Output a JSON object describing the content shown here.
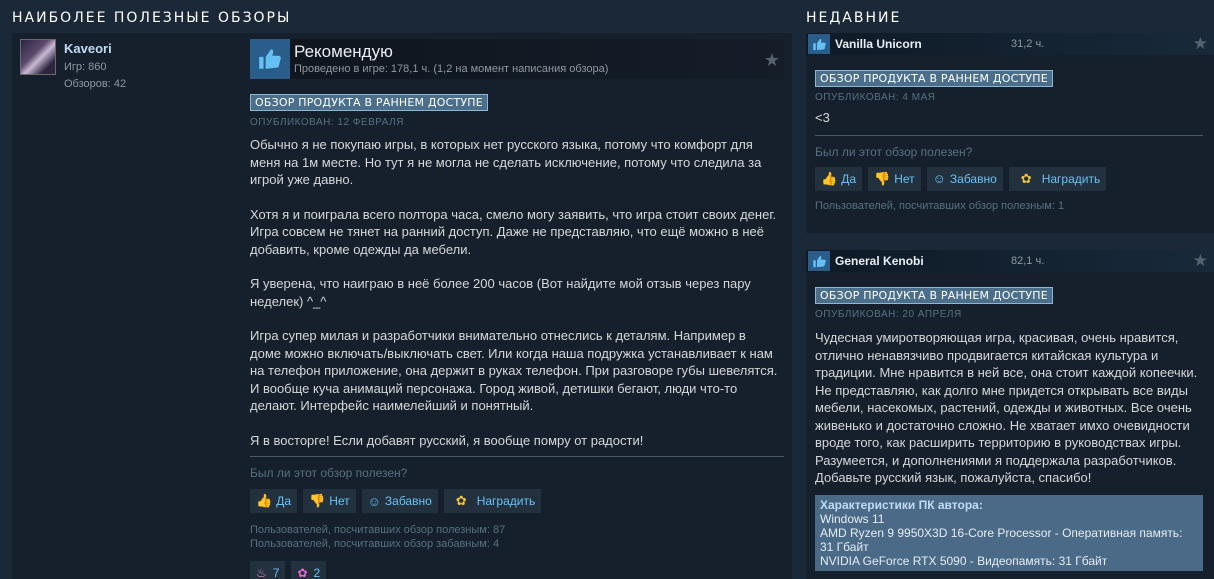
{
  "sections": {
    "most_helpful": "НАИБОЛЕЕ ПОЛЕЗНЫЕ ОБЗОРЫ",
    "recent": "НЕДАВНИЕ"
  },
  "main_review": {
    "author": "Kaveori",
    "games": "Игр: 860",
    "reviews": "Обзоров: 42",
    "verdict": "Рекомендую",
    "hours": "Проведено в игре: 178,1 ч. (1,2 на момент написания обзора)",
    "badge": "ОБЗОР ПРОДУКТА В РАННЕМ ДОСТУПЕ",
    "posted": "ОПУБЛИКОВАН: 12 ФЕВРАЛЯ",
    "paragraphs": [
      "Обычно я не покупаю игры, в которых нет русского языка, потому что комфорт для меня на 1м месте. Но тут я не могла не сделать исключение, потому что следила за игрой уже давно.",
      "Хотя я и поиграла всего полтора часа, смело могу заявить, что игра стоит своих денег. Игра совсем не тянет на ранний доступ. Даже не представляю, что ещё можно в неё добавить, кроме одежды да мебели.",
      "Я уверена, что наиграю в неё более 200 часов (Вот найдите мой отзыв через пару неделек) ^_^",
      "Игра супер милая и разработчики внимательно отнеслись к деталям. Например в доме можно включать/выключать свет. Или когда наша подружка устанавливает к нам на телефон приложение, она держит в руках телефон. При разговоре губы шевелятся. И вообще куча анимаций персонажа. Город живой, детишки бегают, люди что-то делают. Интерфейс наимелейший и понятный.",
      "Я в восторге! Если добавят русский, я вообще помру от радости!"
    ],
    "helpful_question": "Был ли этот обзор полезен?",
    "buttons": {
      "yes": "Да",
      "no": "Нет",
      "funny": "Забавно",
      "award": "Наградить"
    },
    "helpful_count": "Пользователей, посчитавших обзор полезным: 87",
    "funny_count": "Пользователей, посчитавших обзор забавным: 4",
    "awards": [
      {
        "icon": "cake-icon",
        "count": "7"
      },
      {
        "icon": "flower-icon",
        "count": "2"
      }
    ]
  },
  "recent_reviews": [
    {
      "author": "Vanilla Unicorn",
      "hours": "31,2 ч.",
      "badge": "ОБЗОР ПРОДУКТА В РАННЕМ ДОСТУПЕ",
      "posted": "ОПУБЛИКОВАН: 4 МАЯ",
      "text": "<3",
      "helpful_question": "Был ли этот обзор полезен?",
      "buttons": {
        "yes": "Да",
        "no": "Нет",
        "funny": "Забавно",
        "award": "Наградить"
      },
      "helpful_count": "Пользователей, посчитавших обзор полезным: 1"
    },
    {
      "author": "General Kenobi",
      "hours": "82,1 ч.",
      "badge": "ОБЗОР ПРОДУКТА В РАННЕМ ДОСТУПЕ",
      "posted": "ОПУБЛИКОВАН: 20 АПРЕЛЯ",
      "text": "Чудесная умиротворяющая игра, красивая, очень нравится, отлично ненавязчиво продвигается китайская культура и традиции. Мне нравится в ней все, она стоит каждой копеечки. Не представляю, как долго мне придется открывать все виды мебели, насекомых, растений, одежды и животных. Все очень живенько и достаточно сложно. Не хватает имхо очевидности вроде того, как расширить территорию в руководствах игры. Разумеется, и дополнениями я поддержала разработчиков. Добавьте русский язык, пожалуйста, спасибо!",
      "specs_title": "Характеристики ПК автора:",
      "specs": [
        "Windows 11",
        "AMD Ryzen 9 9950X3D 16-Core Processor - Оперативная память: 31 Гбайт",
        "NVIDIA GeForce RTX 5090 - Видеопамять: 31 Гбайт"
      ]
    }
  ]
}
